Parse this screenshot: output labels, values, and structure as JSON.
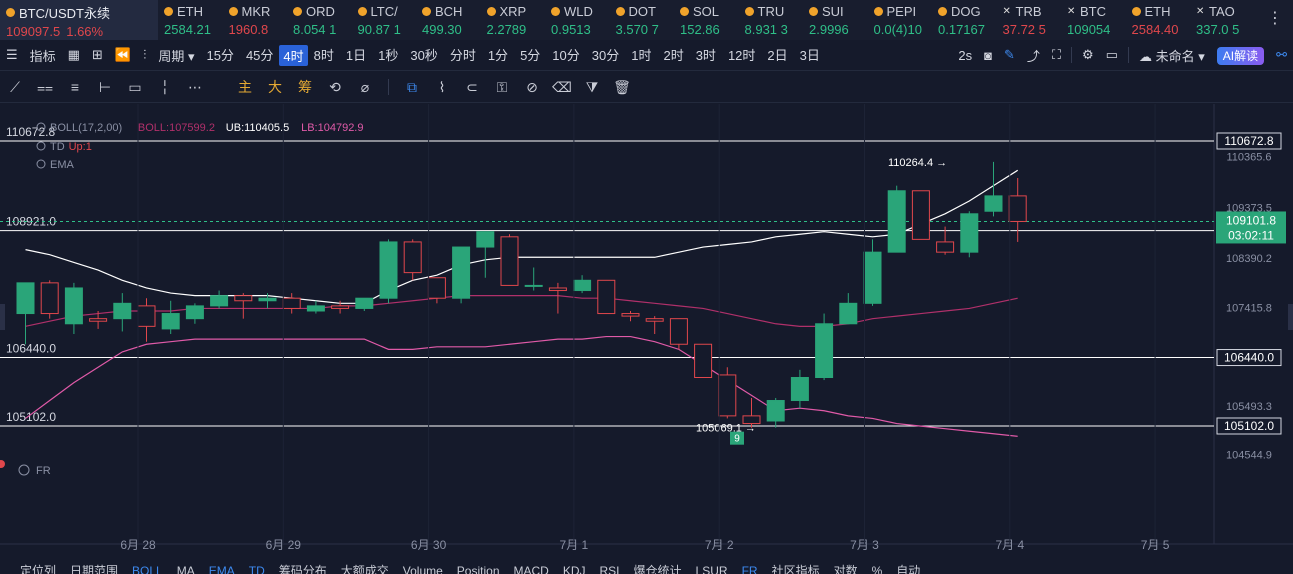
{
  "main_ticker": {
    "symbol": "BTC/USDT永续",
    "price": "109097.5",
    "change": "1.66%"
  },
  "tickers": [
    {
      "name": "ETH",
      "value": "2584.21",
      "dir": "up"
    },
    {
      "name": "MKR",
      "value": "1960.8",
      "dir": "dn"
    },
    {
      "name": "ORD",
      "value": "8.054 1",
      "dir": "up"
    },
    {
      "name": "LTC/",
      "value": "90.87 1",
      "dir": "up"
    },
    {
      "name": "BCH",
      "value": "499.30",
      "dir": "up"
    },
    {
      "name": "XRP",
      "value": "2.2789",
      "dir": "up"
    },
    {
      "name": "WLD",
      "value": "0.9513",
      "dir": "up"
    },
    {
      "name": "DOT",
      "value": "3.570 7",
      "dir": "up"
    },
    {
      "name": "SOL",
      "value": "152.86",
      "dir": "up"
    },
    {
      "name": "TRU",
      "value": "8.931 3",
      "dir": "up"
    },
    {
      "name": "SUI",
      "value": "2.9996",
      "dir": "up"
    },
    {
      "name": "PEPI",
      "value": "0.0(4)10",
      "dir": "up"
    },
    {
      "name": "DOG",
      "value": "0.17167",
      "dir": "up"
    },
    {
      "name": "TRB",
      "value": "37.72 5",
      "dir": "dn"
    },
    {
      "name": "BTC",
      "value": "109054",
      "dir": "up"
    },
    {
      "name": "ETH",
      "value": "2584.40",
      "dir": "dn"
    },
    {
      "name": "TAO",
      "value": "337.0 5",
      "dir": "up"
    }
  ],
  "toolbar": {
    "indicator": "指标",
    "period": "周期",
    "intervals": [
      "15分",
      "45分",
      "4时",
      "8时",
      "1日",
      "1秒",
      "30秒",
      "分时",
      "1分",
      "5分",
      "10分",
      "30分",
      "1时",
      "2时",
      "3时",
      "12时",
      "2日",
      "3日"
    ],
    "active_interval": "4时",
    "refresh": "2s",
    "layout_name": "未命名",
    "ai_label": "AI解读"
  },
  "drawing_tools": {
    "labels": [
      "主",
      "大",
      "筹"
    ]
  },
  "indicators": {
    "boll_label": "BOLL(17,2,00)",
    "boll_mid": "BOLL:107599.2",
    "boll_ub": "UB:110405.5",
    "boll_lb": "LB:104792.9",
    "td": "TD",
    "td_up": "Up:1",
    "ema": "EMA",
    "fr": "FR"
  },
  "price_axis": {
    "ticks": [
      "110365.6",
      "109373.5",
      "108390.2",
      "107415.8",
      "105493.3",
      "104544.9"
    ],
    "hlines": [
      {
        "value": 110672.8,
        "label": "110672.8"
      },
      {
        "value": 108921.0,
        "label": "108921.0"
      },
      {
        "value": 106440.0,
        "label": "106440.0"
      },
      {
        "value": 105102.0,
        "label": "105102.0"
      }
    ],
    "current_price": "109101.8",
    "countdown": "03:02:11"
  },
  "time_axis": [
    "6月 28",
    "6月 29",
    "6月 30",
    "7月 1",
    "7月 2",
    "7月 3",
    "7月 4",
    "7月 5"
  ],
  "annotations": {
    "high": "110264.4",
    "low": "105069.1",
    "td_count": "9"
  },
  "bottom_tabs": [
    "定位列",
    "日期范围",
    "BOLL",
    "MA",
    "EMA",
    "TD",
    "筹码分布",
    "大额成交",
    "Volume",
    "Position",
    "MACD",
    "KDJ",
    "RSI",
    "爆仓统计",
    "LSUR",
    "FR",
    "社区指标",
    "对数",
    "%",
    "自动"
  ],
  "chart_data": {
    "type": "candlestick",
    "timeframe": "4时",
    "candles": [
      {
        "o": 107300,
        "h": 107500,
        "c": 107900,
        "l": 106700
      },
      {
        "o": 107900,
        "h": 107950,
        "c": 107300,
        "l": 107200
      },
      {
        "o": 107100,
        "h": 107900,
        "c": 107800,
        "l": 106900
      },
      {
        "o": 107200,
        "h": 107350,
        "c": 107150,
        "l": 107000
      },
      {
        "o": 107200,
        "h": 107700,
        "c": 107500,
        "l": 106950
      },
      {
        "o": 107450,
        "h": 107600,
        "c": 107050,
        "l": 106750
      },
      {
        "o": 107000,
        "h": 107550,
        "c": 107300,
        "l": 106900
      },
      {
        "o": 107200,
        "h": 107500,
        "c": 107450,
        "l": 107100
      },
      {
        "o": 107450,
        "h": 107750,
        "c": 107650,
        "l": 107400
      },
      {
        "o": 107650,
        "h": 107700,
        "c": 107550,
        "l": 107200
      },
      {
        "o": 107550,
        "h": 107700,
        "c": 107600,
        "l": 107400
      },
      {
        "o": 107600,
        "h": 107700,
        "c": 107400,
        "l": 107300
      },
      {
        "o": 107350,
        "h": 107550,
        "c": 107450,
        "l": 107300
      },
      {
        "o": 107450,
        "h": 107550,
        "c": 107400,
        "l": 107300
      },
      {
        "o": 107400,
        "h": 107600,
        "c": 107600,
        "l": 107350
      },
      {
        "o": 107600,
        "h": 108750,
        "c": 108700,
        "l": 107500
      },
      {
        "o": 108700,
        "h": 108750,
        "c": 108100,
        "l": 107950
      },
      {
        "o": 108000,
        "h": 108000,
        "c": 107600,
        "l": 107500
      },
      {
        "o": 107600,
        "h": 108600,
        "c": 108600,
        "l": 107500
      },
      {
        "o": 108600,
        "h": 108900,
        "c": 108900,
        "l": 108000
      },
      {
        "o": 108800,
        "h": 108850,
        "c": 107850,
        "l": 107850
      },
      {
        "o": 107850,
        "h": 108200,
        "c": 107850,
        "l": 107750
      },
      {
        "o": 107800,
        "h": 107900,
        "c": 107750,
        "l": 107300
      },
      {
        "o": 107750,
        "h": 108050,
        "c": 107950,
        "l": 107700
      },
      {
        "o": 107950,
        "h": 107950,
        "c": 107300,
        "l": 107300
      },
      {
        "o": 107300,
        "h": 107350,
        "c": 107250,
        "l": 107150
      },
      {
        "o": 107200,
        "h": 107250,
        "c": 107150,
        "l": 106900
      },
      {
        "o": 107200,
        "h": 107200,
        "c": 106700,
        "l": 106600
      },
      {
        "o": 106700,
        "h": 106700,
        "c": 106050,
        "l": 106050
      },
      {
        "o": 106100,
        "h": 106250,
        "c": 105300,
        "l": 105250
      },
      {
        "o": 105300,
        "h": 105650,
        "c": 105150,
        "l": 105069
      },
      {
        "o": 105200,
        "h": 105650,
        "c": 105600,
        "l": 105069
      },
      {
        "o": 105600,
        "h": 106200,
        "c": 106050,
        "l": 105450
      },
      {
        "o": 106050,
        "h": 107300,
        "c": 107100,
        "l": 106000
      },
      {
        "o": 107100,
        "h": 107700,
        "c": 107500,
        "l": 107100
      },
      {
        "o": 107500,
        "h": 108750,
        "c": 108500,
        "l": 107450
      },
      {
        "o": 108500,
        "h": 109800,
        "c": 109700,
        "l": 108500
      },
      {
        "o": 109700,
        "h": 109700,
        "c": 108750,
        "l": 108750
      },
      {
        "o": 108700,
        "h": 109000,
        "c": 108500,
        "l": 108450
      },
      {
        "o": 108500,
        "h": 109300,
        "c": 109250,
        "l": 108400
      },
      {
        "o": 109300,
        "h": 110264,
        "c": 109600,
        "l": 109200
      },
      {
        "o": 109600,
        "h": 109950,
        "c": 109100,
        "l": 108700
      }
    ],
    "boll_upper": [
      108550,
      108450,
      108300,
      108150,
      107950,
      107800,
      107700,
      107650,
      107650,
      107650,
      107650,
      107600,
      107550,
      107500,
      107500,
      107750,
      107950,
      108050,
      108250,
      108350,
      108400,
      108400,
      108400,
      108400,
      108400,
      108400,
      108400,
      108500,
      108600,
      108650,
      108700,
      108800,
      108850,
      108900,
      108850,
      108800,
      108850,
      109050,
      109250,
      109500,
      109800,
      110100
    ],
    "boll_mid": [
      107050,
      107150,
      107250,
      107300,
      107350,
      107350,
      107350,
      107400,
      107400,
      107400,
      107400,
      107400,
      107400,
      107450,
      107450,
      107500,
      107550,
      107600,
      107650,
      107650,
      107650,
      107650,
      107650,
      107600,
      107600,
      107550,
      107500,
      107450,
      107400,
      107300,
      107200,
      107100,
      107050,
      107050,
      107100,
      107200,
      107250,
      107300,
      107350,
      107400,
      107500,
      107600
    ],
    "boll_lower": [
      105250,
      105600,
      105950,
      106250,
      106550,
      106700,
      106750,
      106800,
      106800,
      106800,
      106800,
      106800,
      106800,
      106800,
      106800,
      106600,
      106600,
      106650,
      106650,
      106650,
      106700,
      106750,
      106800,
      106800,
      106850,
      106850,
      106750,
      106600,
      106300,
      106000,
      105700,
      105400,
      105450,
      105400,
      105300,
      105250,
      105150,
      105100,
      105050,
      105000,
      104950,
      104900
    ]
  }
}
